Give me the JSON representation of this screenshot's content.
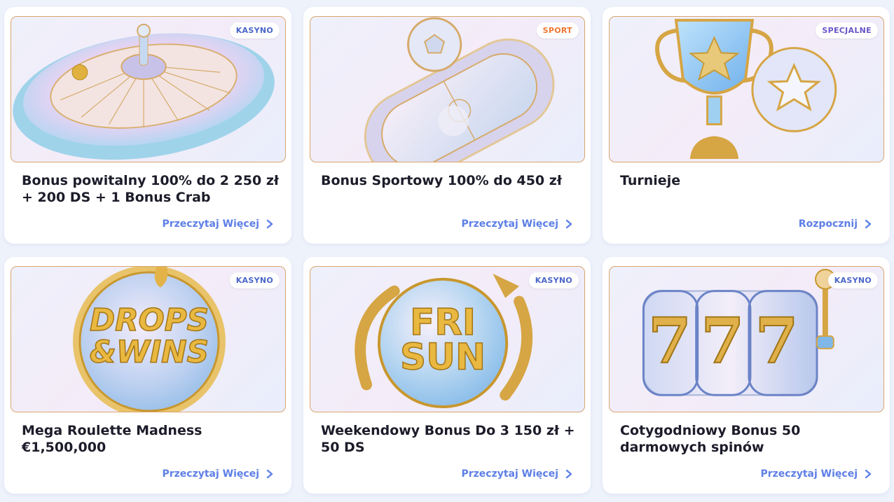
{
  "cards": [
    {
      "badge": "KASYNO",
      "title": "Bonus powitalny 100% do 2 250 zł + 200 DS + 1 Bonus Crab",
      "cta": "Przeczytaj Więcej",
      "icon": "roulette-wheel"
    },
    {
      "badge": "SPORT",
      "title": "Bonus Sportowy 100% do 450 zł",
      "cta": "Przeczytaj Więcej",
      "icon": "stadium-ball"
    },
    {
      "badge": "SPECJALNE",
      "title": "Turnieje",
      "cta": "Rozpocznij",
      "icon": "trophy-ball"
    },
    {
      "badge": "KASYNO",
      "title": "Mega Roulette Madness €1,500,000",
      "cta": "Przeczytaj Więcej",
      "icon": "drops-wins",
      "art_text": [
        "DROPS",
        "&WINS"
      ]
    },
    {
      "badge": "KASYNO",
      "title": "Weekendowy Bonus Do 3 150 zł + 50 DS",
      "cta": "Przeczytaj Więcej",
      "icon": "fri-sun",
      "art_text": [
        "FRI",
        "SUN"
      ]
    },
    {
      "badge": "KASYNO",
      "title": "Cotygodniowy Bonus 50 darmowych spinów",
      "cta": "Przeczytaj Więcej",
      "icon": "slot-777",
      "art_text": [
        "7",
        "7",
        "7"
      ]
    }
  ],
  "colors": {
    "badge_kasyno": "#4a66c9",
    "badge_sport": "#ee7630",
    "badge_specjalne": "#6a55c8",
    "link": "#5d7fe6",
    "gold": "#d6a544"
  }
}
